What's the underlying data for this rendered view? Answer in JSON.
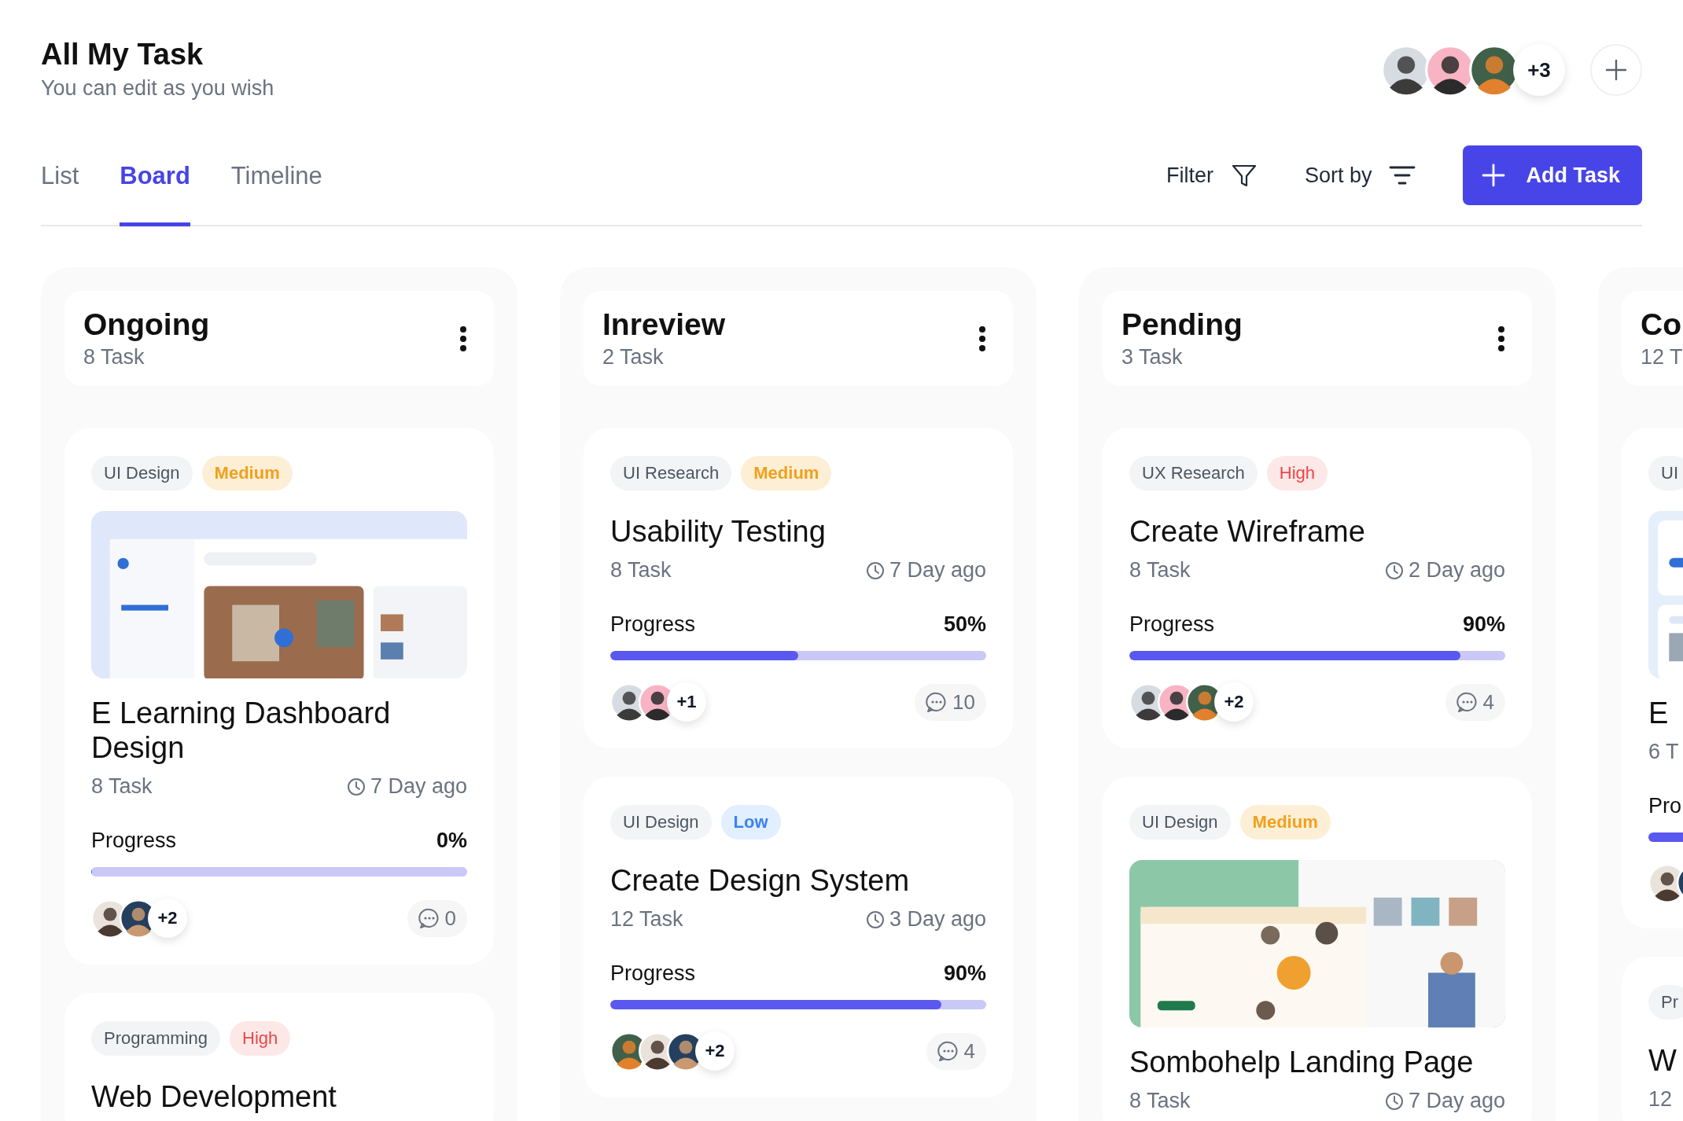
{
  "header": {
    "title": "All My Task",
    "subtitle": "You can edit as you wish"
  },
  "members": {
    "avatars": [
      {
        "kind": "avatar"
      },
      {
        "kind": "avatar"
      },
      {
        "kind": "avatar"
      }
    ],
    "extra": "+3"
  },
  "tabs": [
    {
      "label": "List",
      "selected": false
    },
    {
      "label": "Board",
      "selected": true
    },
    {
      "label": "Timeline",
      "selected": false
    }
  ],
  "toolbar": {
    "filter": "Filter",
    "sort": "Sort by",
    "add_button": "Add Task"
  },
  "columns": [
    {
      "title": "Ongoing",
      "count": "8 Task",
      "menu": true,
      "cards": [
        {
          "tags": [
            {
              "label": "UI Design",
              "kind": "category"
            },
            {
              "label": "Medium",
              "kind": "medium"
            }
          ],
          "image": {
            "kind": "picture"
          },
          "title": "E Learning Dashboard Design",
          "tasks": "8 Task",
          "time": "7 Day ago",
          "progress_label": "Progress",
          "percent": "0%",
          "level": 0,
          "avatars": [
            {
              "kind": "avatar"
            },
            {
              "kind": "avatar"
            }
          ],
          "extra": "+2",
          "comments": "0"
        },
        {
          "tags": [
            {
              "label": "Programming",
              "kind": "category"
            },
            {
              "label": "High",
              "kind": "high"
            }
          ],
          "title": "Web Development"
        }
      ]
    },
    {
      "title": "Inreview",
      "count": "2 Task",
      "menu": true,
      "cards": [
        {
          "tags": [
            {
              "label": "UI Research",
              "kind": "category"
            },
            {
              "label": "Medium",
              "kind": "medium"
            }
          ],
          "title": "Usability Testing",
          "tasks": "8 Task",
          "time": "7 Day ago",
          "progress_label": "Progress",
          "percent": "50%",
          "level": 0.5,
          "avatars": [
            {
              "kind": "avatar"
            },
            {
              "kind": "avatar"
            }
          ],
          "extra": "+1",
          "comments": "10"
        },
        {
          "tags": [
            {
              "label": "UI Design",
              "kind": "category"
            },
            {
              "label": "Low",
              "kind": "low"
            }
          ],
          "title": "Create Design System",
          "tasks": "12 Task",
          "time": "3 Day ago",
          "progress_label": "Progress",
          "percent": "90%",
          "level": 0.88,
          "avatars": [
            {
              "kind": "avatar"
            },
            {
              "kind": "avatar"
            },
            {
              "kind": "avatar"
            }
          ],
          "extra": "+2",
          "comments": "4"
        }
      ]
    },
    {
      "title": "Pending",
      "count": "3 Task",
      "menu": true,
      "cards": [
        {
          "tags": [
            {
              "label": "UX Research",
              "kind": "category"
            },
            {
              "label": "High",
              "kind": "high"
            }
          ],
          "title": "Create Wireframe",
          "tasks": "8 Task",
          "time": "2 Day ago",
          "progress_label": "Progress",
          "percent": "90%",
          "level": 0.88,
          "avatars": [
            {
              "kind": "avatar"
            },
            {
              "kind": "avatar"
            },
            {
              "kind": "avatar"
            }
          ],
          "extra": "+2",
          "comments": "4"
        },
        {
          "tags": [
            {
              "label": "UI Design",
              "kind": "category"
            },
            {
              "label": "Medium",
              "kind": "medium"
            }
          ],
          "image": {
            "kind": "picture"
          },
          "title": "Sombohelp Landing Page",
          "tasks": "8 Task",
          "time": "7 Day ago"
        }
      ]
    },
    {
      "title": "Co",
      "count": "12 T",
      "cards": [
        {
          "tags": [
            {
              "label": "UI",
              "kind": "category"
            }
          ],
          "image": {
            "kind": "picture"
          },
          "title": "E",
          "tasks": "6 T",
          "progress_label": "Pro",
          "avatars": [
            {
              "kind": "avatar"
            },
            {
              "kind": "avatar"
            }
          ]
        },
        {
          "tags": [
            {
              "label": "Pr",
              "kind": "category"
            }
          ],
          "title": "W",
          "tasks": "12"
        }
      ]
    }
  ]
}
